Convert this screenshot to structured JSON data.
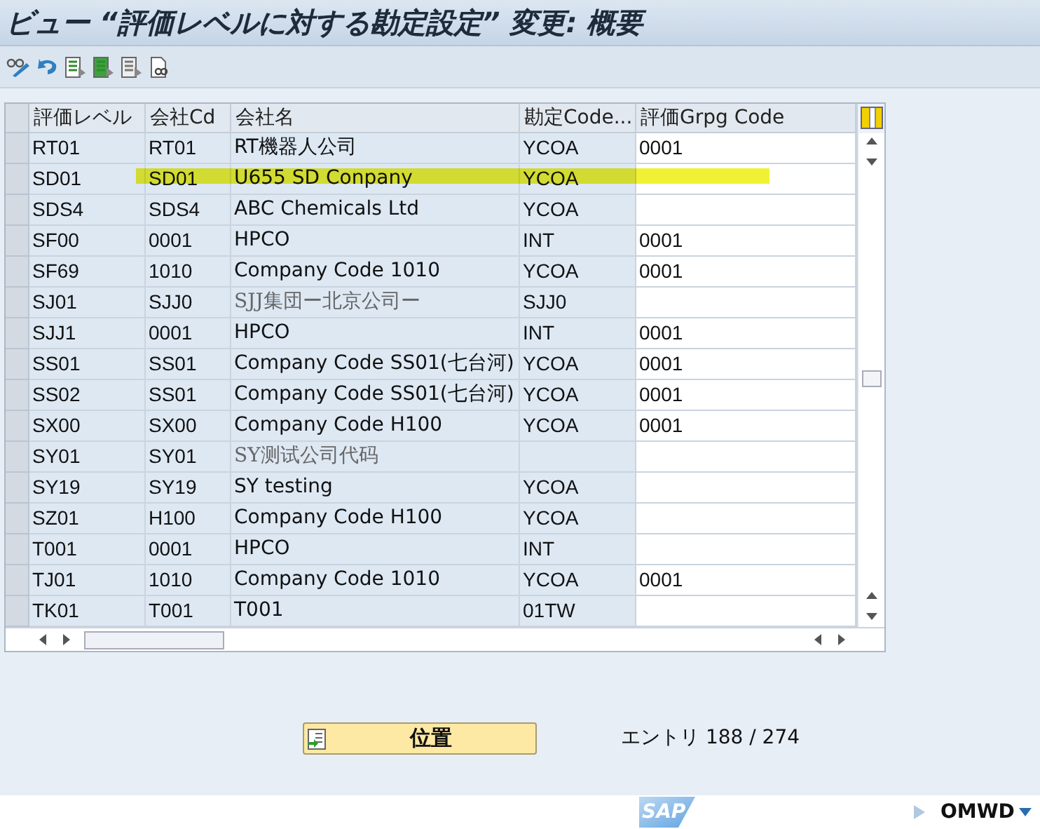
{
  "window": {
    "title": "ビュー “評価レベルに対する勘定設定” 変更: 概要"
  },
  "table": {
    "columns": [
      "評価レベル",
      "会社Cd",
      "会社名",
      "勘定Code...",
      "評価Grpg Code"
    ],
    "rows": [
      {
        "level": "RT01",
        "company_cd": "RT01",
        "company_name": "RT機器人公司",
        "account_code": "YCOA",
        "grpg_code": "0001",
        "name_greyed": false,
        "highlighted": false
      },
      {
        "level": "SD01",
        "company_cd": "SD01",
        "company_name": "U655 SD Conpany",
        "account_code": "YCOA",
        "name_greyed": false,
        "highlighted": true
      },
      {
        "level": "SDS4",
        "company_cd": "SDS4",
        "company_name": "ABC Chemicals Ltd",
        "account_code": "YCOA",
        "name_greyed": false,
        "highlighted": false
      },
      {
        "level": "SF00",
        "company_cd": "0001",
        "company_name": "HPCO",
        "account_code": "INT",
        "grpg_code": "0001",
        "name_greyed": false,
        "highlighted": false
      },
      {
        "level": "SF69",
        "company_cd": "1010",
        "company_name": "Company Code 1010",
        "account_code": "YCOA",
        "grpg_code": "0001",
        "name_greyed": false,
        "highlighted": false
      },
      {
        "level": "SJ01",
        "company_cd": "SJJ0",
        "company_name": "SJJ集団ー北京公司ー",
        "account_code": "SJJ0",
        "name_greyed": true,
        "highlighted": false
      },
      {
        "level": "SJJ1",
        "company_cd": "0001",
        "company_name": "HPCO",
        "account_code": "INT",
        "grpg_code": "0001",
        "name_greyed": false,
        "highlighted": false
      },
      {
        "level": "SS01",
        "company_cd": "SS01",
        "company_name": "Company Code SS01(七台河)",
        "account_code": "YCOA",
        "grpg_code": "0001",
        "name_greyed": false,
        "highlighted": false
      },
      {
        "level": "SS02",
        "company_cd": "SS01",
        "company_name": "Company Code SS01(七台河)",
        "account_code": "YCOA",
        "grpg_code": "0001",
        "name_greyed": false,
        "highlighted": false
      },
      {
        "level": "SX00",
        "company_cd": "SX00",
        "company_name": "Company Code H100",
        "account_code": "YCOA",
        "grpg_code": "0001",
        "name_greyed": false,
        "highlighted": false
      },
      {
        "level": "SY01",
        "company_cd": "SY01",
        "company_name": "SY测试公司代码",
        "name_greyed": true,
        "highlighted": false
      },
      {
        "level": "SY19",
        "company_cd": "SY19",
        "company_name": "SY testing",
        "account_code": "YCOA",
        "name_greyed": false,
        "highlighted": false
      },
      {
        "level": "SZ01",
        "company_cd": "H100",
        "company_name": "Company Code H100",
        "account_code": "YCOA",
        "name_greyed": false,
        "highlighted": false
      },
      {
        "level": "T001",
        "company_cd": "0001",
        "company_name": "HPCO",
        "account_code": "INT",
        "name_greyed": false,
        "highlighted": false
      },
      {
        "level": "TJ01",
        "company_cd": "1010",
        "company_name": "Company Code 1010",
        "account_code": "YCOA",
        "grpg_code": "0001",
        "name_greyed": false,
        "highlighted": false
      },
      {
        "level": "TK01",
        "company_cd": "T001",
        "company_name": "T001",
        "account_code": "01TW",
        "name_greyed": false,
        "highlighted": false
      }
    ]
  },
  "position_button": {
    "label": "位置"
  },
  "entry_count": "エントリ 188 / 274",
  "status_bar": {
    "logo": "SAP",
    "transaction": "OMWD"
  }
}
